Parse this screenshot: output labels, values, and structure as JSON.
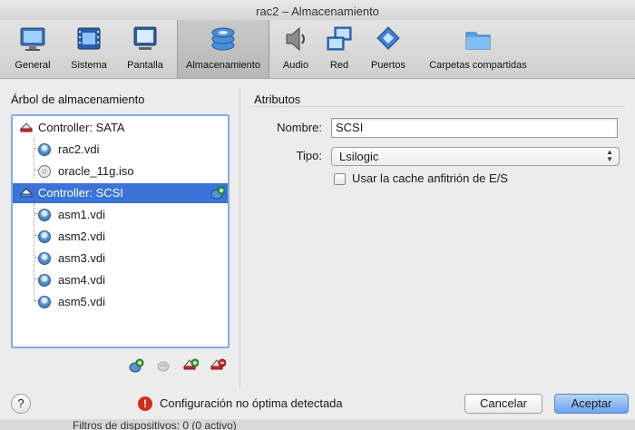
{
  "window": {
    "title": "rac2 – Almacenamiento"
  },
  "toolbar": {
    "items": [
      {
        "label": "General",
        "icon": "monitor-icon"
      },
      {
        "label": "Sistema",
        "icon": "chip-icon"
      },
      {
        "label": "Pantalla",
        "icon": "display-icon"
      },
      {
        "label": "Almacenamiento",
        "icon": "storage-icon",
        "selected": true
      },
      {
        "label": "Audio",
        "icon": "speaker-icon"
      },
      {
        "label": "Red",
        "icon": "network-icon"
      },
      {
        "label": "Puertos",
        "icon": "ports-icon"
      },
      {
        "label": "Carpetas compartidas",
        "icon": "folder-icon"
      }
    ]
  },
  "storage_tree": {
    "heading": "Árbol de almacenamiento",
    "rows": [
      {
        "label": "Controller: SATA",
        "kind": "controller"
      },
      {
        "label": "rac2.vdi",
        "kind": "disk"
      },
      {
        "label": "oracle_11g.iso",
        "kind": "cd"
      },
      {
        "label": "Controller: SCSI",
        "kind": "controller",
        "selected": true
      },
      {
        "label": "asm1.vdi",
        "kind": "disk"
      },
      {
        "label": "asm2.vdi",
        "kind": "disk"
      },
      {
        "label": "asm3.vdi",
        "kind": "disk"
      },
      {
        "label": "asm4.vdi",
        "kind": "disk"
      },
      {
        "label": "asm5.vdi",
        "kind": "disk"
      }
    ]
  },
  "attributes": {
    "heading": "Atributos",
    "name_label": "Nombre:",
    "name_value": "SCSI",
    "type_label": "Tipo:",
    "type_value": "Lsilogic",
    "cache_label": "Usar la cache anfitrión de E/S",
    "cache_checked": false
  },
  "footer": {
    "help": "?",
    "warning_text": "Configuración no óptima detectada",
    "cancel_label": "Cancelar",
    "ok_label": "Aceptar",
    "behind_text": "Filtros de dispositivos:   0 (0 activo)"
  },
  "colors": {
    "selection": "#3a74d6",
    "accent": "#6aa3ef",
    "warning": "#d52b1e"
  }
}
